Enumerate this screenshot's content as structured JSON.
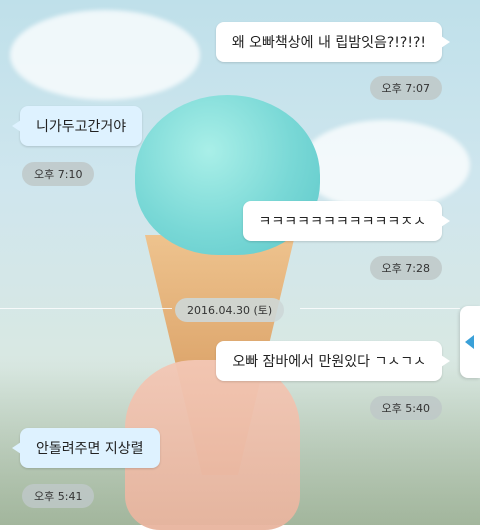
{
  "messages": [
    {
      "side": "right",
      "text": "왜 오빠책상에 내 립밤잇음?!?!?!"
    },
    {
      "side": "left",
      "text": "니가두고간거야"
    },
    {
      "side": "right",
      "text": "ㅋㅋㅋㅋㅋㅋㅋㅋㅋㅋㅋㅈㅅ"
    },
    {
      "side": "right",
      "text": "오빠 잠바에서 만원있다 ㄱㅅㄱㅅ"
    },
    {
      "side": "left",
      "text": "안돌려주면 지상렬"
    }
  ],
  "times": [
    "오후 7:07",
    "오후 7:10",
    "오후 7:28",
    "오후 5:40",
    "오후 5:41"
  ],
  "date_divider": "2016.04.30 (토)",
  "colors": {
    "left_bubble": "#def2ff",
    "right_bubble": "#ffffff",
    "accent": "#3aa0d8"
  },
  "icons": {
    "scroll_handle": "chevron-left-icon"
  }
}
